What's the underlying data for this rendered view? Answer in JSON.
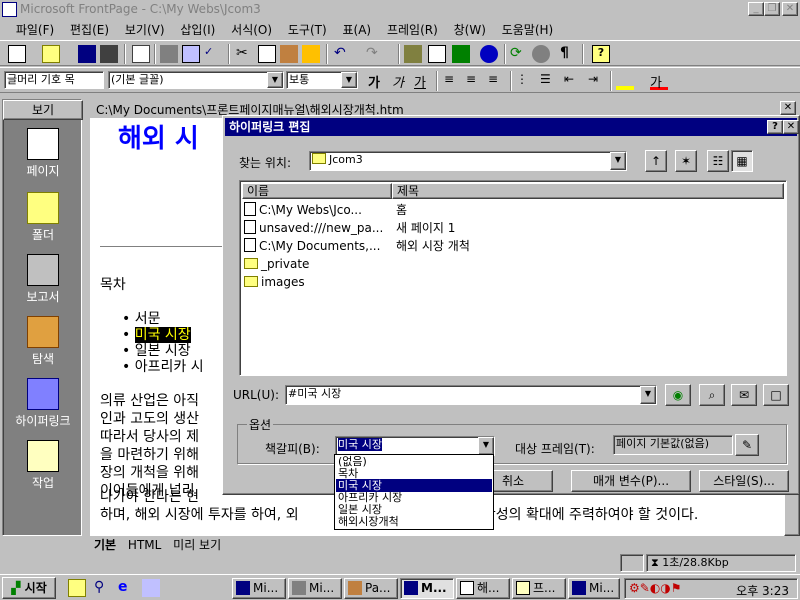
{
  "window": {
    "title": "Microsoft FrontPage - C:\\My Webs\\Jcom3"
  },
  "menu": [
    "파일(F)",
    "편집(E)",
    "보기(V)",
    "삽입(I)",
    "서식(O)",
    "도구(T)",
    "표(A)",
    "프레임(R)",
    "창(W)",
    "도움말(H)"
  ],
  "format_toolbar": {
    "style": "글머리 기호 목",
    "font": "(기본 글꼴)",
    "size": "보통",
    "bold": "가",
    "italic": "가",
    "underline": "가",
    "font_color": "가"
  },
  "views": {
    "header": "보기",
    "items": [
      "페이지",
      "폴더",
      "보고서",
      "탐색",
      "하이퍼링크",
      "작업"
    ]
  },
  "document": {
    "path": "C:\\My Documents\\프론트페이지매뉴얼\\해외시장개척.htm",
    "heading": "해외 시",
    "toc": "목차",
    "bullets": [
      "서문",
      "미국 시장",
      "일본 시장",
      "아프리카 시"
    ],
    "para": [
      "의류 산업은 아직",
      "인과 고도의 생산",
      "따라서 당사의 제",
      "을 마련하기 위해",
      "장의 개척을 위해",
      "이어들에게 널리",
      "나가야 한다는 현",
      "하며, 해외 시장에 투자를 하여, 외",
      "생산성의 확대에 주력하여야 할 것이다."
    ],
    "tabs": [
      "기본",
      "HTML",
      "미리 보기"
    ]
  },
  "dialog": {
    "title": "하이퍼링크 편집",
    "look_in_label": "찾는 위치:",
    "look_in_value": "Jcom3",
    "columns": [
      "이름",
      "제목"
    ],
    "files": [
      {
        "name": "C:\\My Webs\\Jco...",
        "title": "홈",
        "type": "file"
      },
      {
        "name": "unsaved:///new_pa...",
        "title": "새 페이지 1",
        "type": "file"
      },
      {
        "name": "C:\\My Documents,...",
        "title": "해외 시장 개척",
        "type": "file"
      },
      {
        "name": "_private",
        "title": "",
        "type": "folder"
      },
      {
        "name": "images",
        "title": "",
        "type": "folder"
      }
    ],
    "url_label": "URL(U):",
    "url_value": "#미국 시장",
    "options_label": "옵션",
    "bookmark_label": "책갈피(B):",
    "bookmark_value": "미국 시장",
    "target_label": "대상 프레임(T):",
    "target_value": "페이지 기본값(없음)",
    "bookmark_options": [
      "(없음)",
      "목차",
      "미국 시장",
      "아프리카 시장",
      "일본 시장",
      "해외시장개척"
    ],
    "cancel": "취소",
    "params": "매개 변수(P)...",
    "style": "스타일(S)..."
  },
  "status": {
    "speed": "1초/28.8Kbp"
  },
  "taskbar": {
    "start": "시작",
    "tasks": [
      "Mi...",
      "Mi...",
      "Pa...",
      "M...",
      "해...",
      "프...",
      "Mi..."
    ],
    "clock": "오후 3:23"
  },
  "colors": {
    "titlebar_active": "#000080",
    "link_blue": "#0000ff",
    "highlight_yellow": "#ffff00"
  }
}
